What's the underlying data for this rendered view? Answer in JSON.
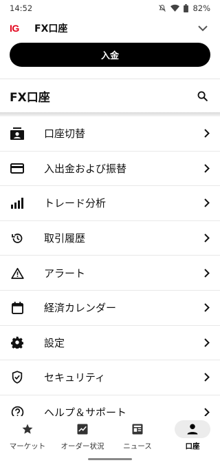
{
  "status_bar": {
    "time": "14:52",
    "battery": "82%"
  },
  "header": {
    "logo": "IG",
    "account_title": "FX口座"
  },
  "deposit_button": {
    "label": "入金"
  },
  "section": {
    "title": "FX口座"
  },
  "menu": [
    {
      "label": "口座切替",
      "icon": "account-switch-icon"
    },
    {
      "label": "入出金および振替",
      "icon": "credit-card-icon"
    },
    {
      "label": "トレード分析",
      "icon": "bar-chart-icon"
    },
    {
      "label": "取引履歴",
      "icon": "history-icon"
    },
    {
      "label": "アラート",
      "icon": "warning-icon"
    },
    {
      "label": "経済カレンダー",
      "icon": "calendar-icon"
    },
    {
      "label": "設定",
      "icon": "gear-icon"
    },
    {
      "label": "セキュリティ",
      "icon": "shield-check-icon"
    },
    {
      "label": "ヘルプ＆サポート",
      "icon": "help-icon"
    }
  ],
  "bottom_nav": [
    {
      "label": "マーケット",
      "icon": "star-icon",
      "active": false
    },
    {
      "label": "オーダー状況",
      "icon": "trend-chart-icon",
      "active": false
    },
    {
      "label": "ニュース",
      "icon": "newspaper-icon",
      "active": false
    },
    {
      "label": "口座",
      "icon": "person-icon",
      "active": true
    }
  ],
  "colors": {
    "brand_red": "#e2001a",
    "primary": "#000000"
  }
}
